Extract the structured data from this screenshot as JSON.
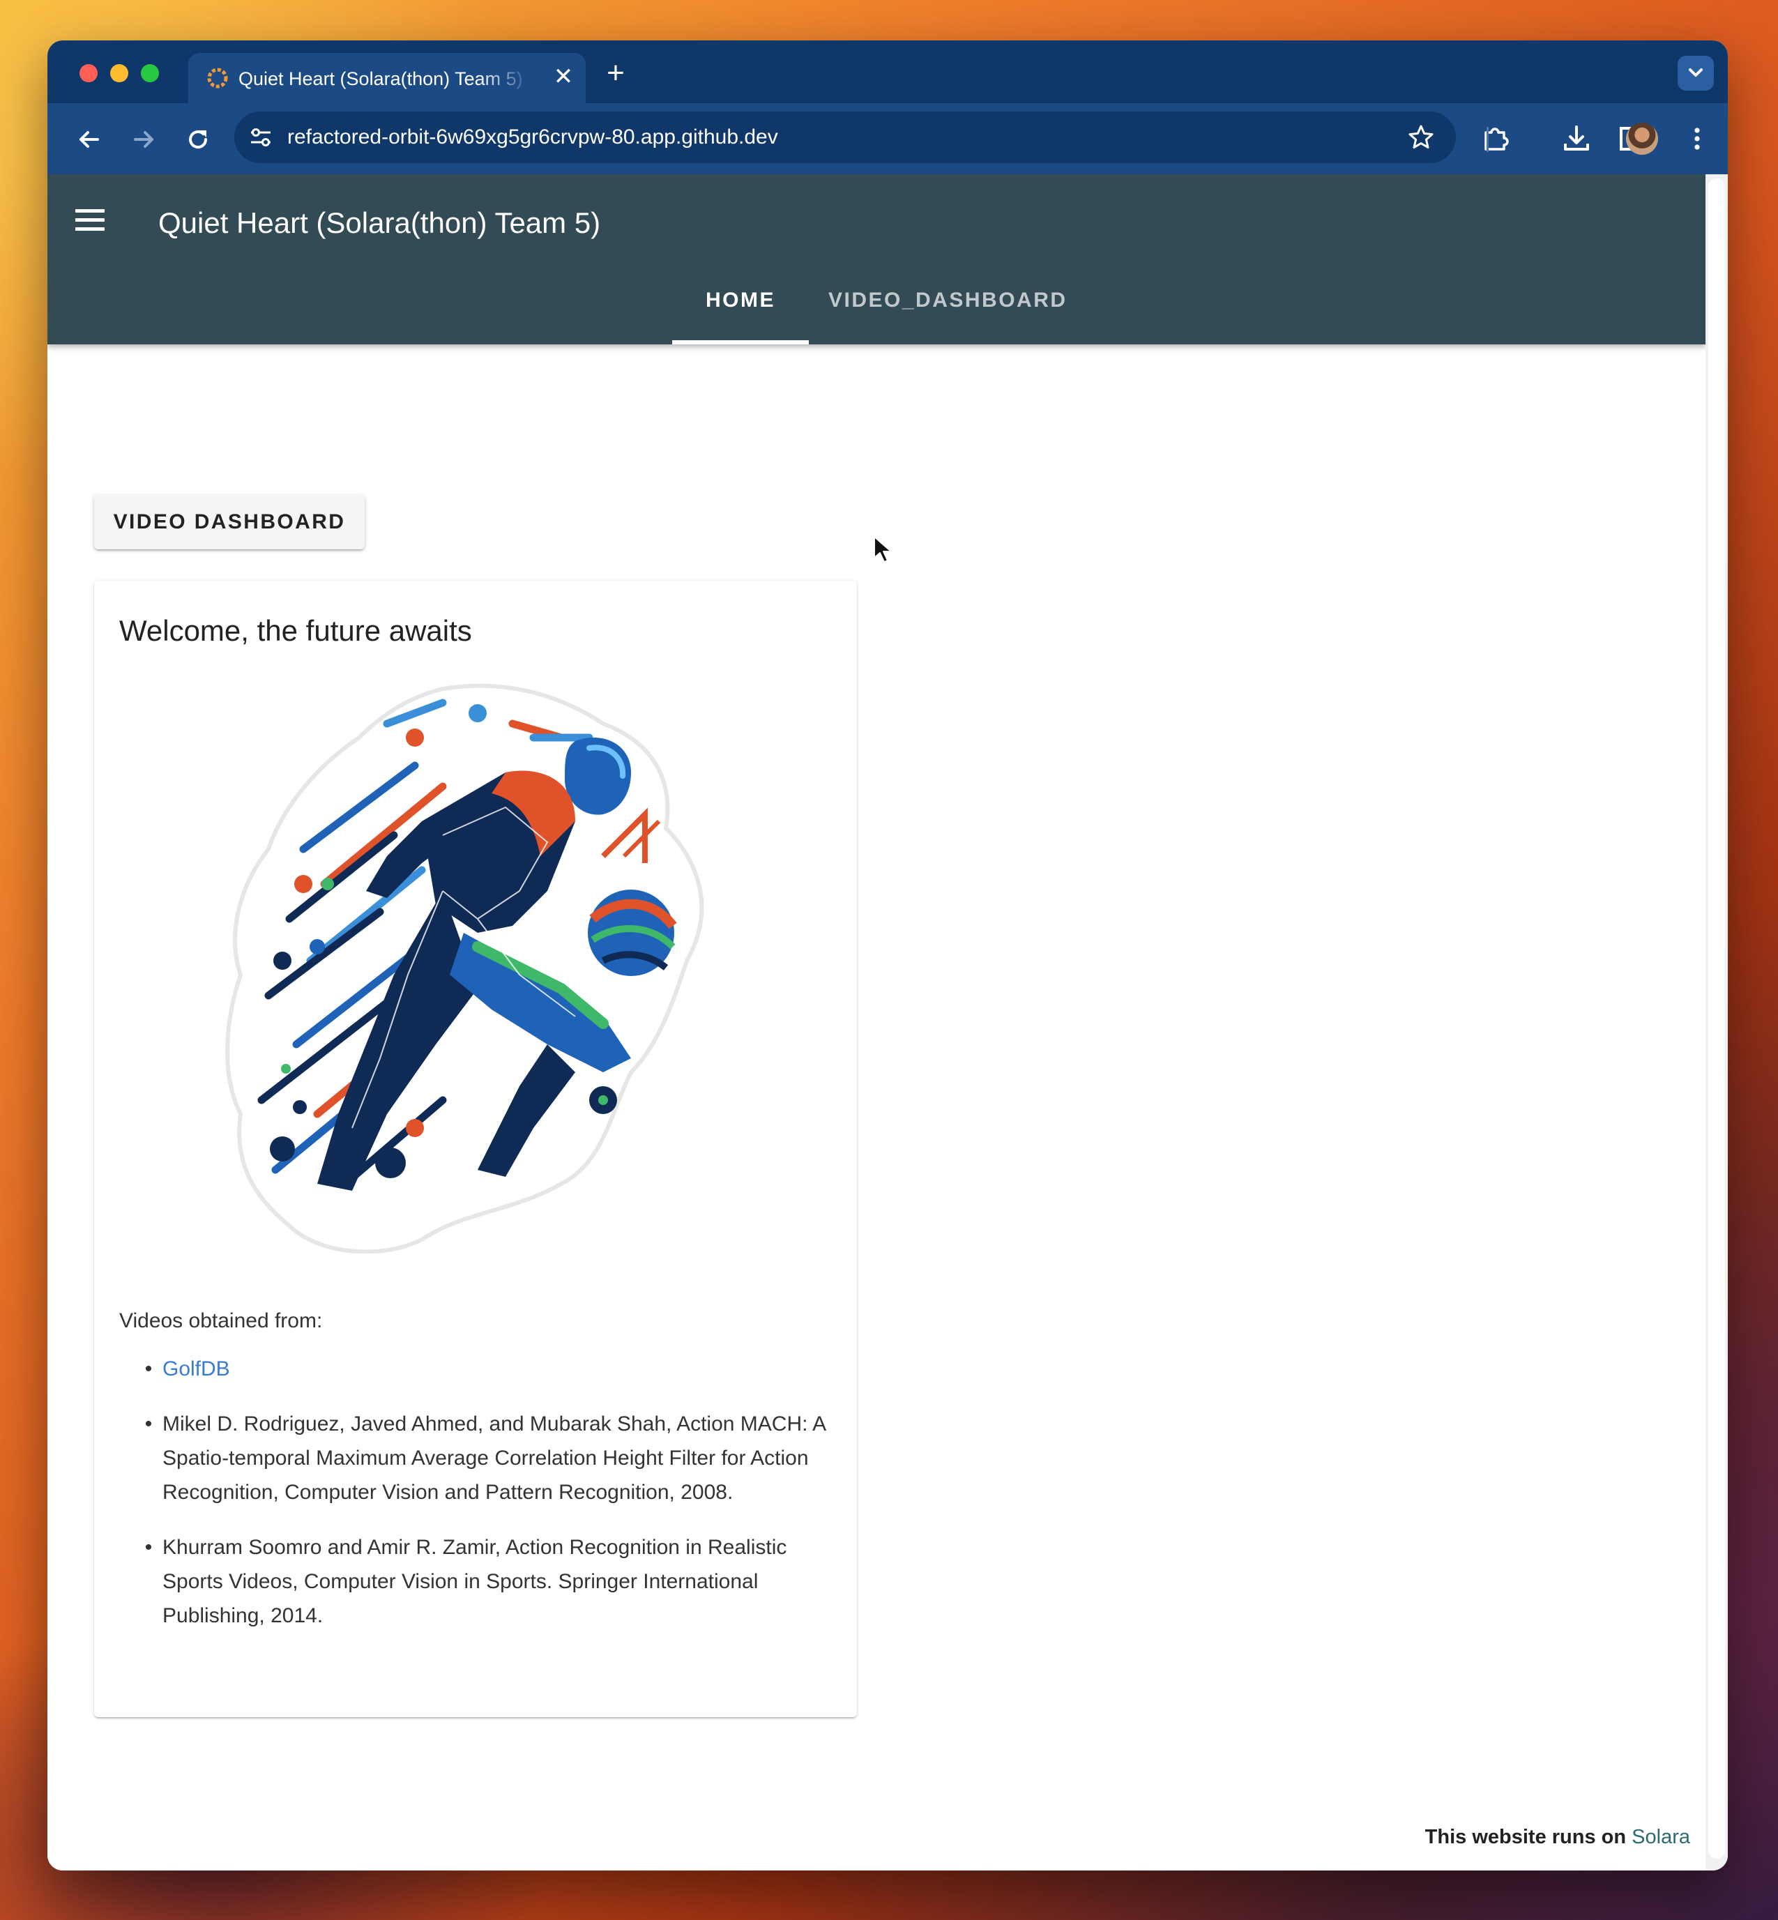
{
  "browser": {
    "tab_title": "Quiet Heart (Solara(thon) Team 5)",
    "tab_close": "✕",
    "new_tab": "+",
    "url": "refactored-orbit-6w69xg5gr6crvpw-80.app.github.dev",
    "icons": [
      "back-icon",
      "forward-icon",
      "reload-icon",
      "site-settings-icon",
      "star-icon",
      "extensions-icon",
      "download-icon",
      "sidebar-icon",
      "profile-avatar",
      "more-menu-icon",
      "tab-search-icon"
    ]
  },
  "app": {
    "title": "Quiet Heart (Solara(thon) Team 5)",
    "nav_tabs": [
      {
        "label": "HOME",
        "active": true
      },
      {
        "label": "VIDEO_DASHBOARD",
        "active": false
      }
    ],
    "header_color": "#324b55"
  },
  "main": {
    "button_label": "VIDEO DASHBOARD",
    "card": {
      "title": "Welcome, the future awaits",
      "sources_label": "Videos obtained from:",
      "sources": [
        {
          "text": "GolfDB",
          "link": true
        },
        {
          "text": "Mikel D. Rodriguez, Javed Ahmed, and Mubarak Shah, Action MACH: A Spatio-temporal Maximum Average Correlation Height Filter for Action Recognition, Computer Vision and Pattern Recognition, 2008.",
          "link": false
        },
        {
          "text": "Khurram Soomro and Amir R. Zamir, Action Recognition in Realistic Sports Videos, Computer Vision in Sports. Springer International Publishing, 2014.",
          "link": false
        }
      ]
    }
  },
  "footer": {
    "prefix": "This website runs on",
    "link": "Solara"
  },
  "colors": {
    "link": "#3a7bd5",
    "footer_link": "#2b6a73",
    "browser_frame": "#0f3769",
    "browser_toolbar": "#1c4a84"
  }
}
